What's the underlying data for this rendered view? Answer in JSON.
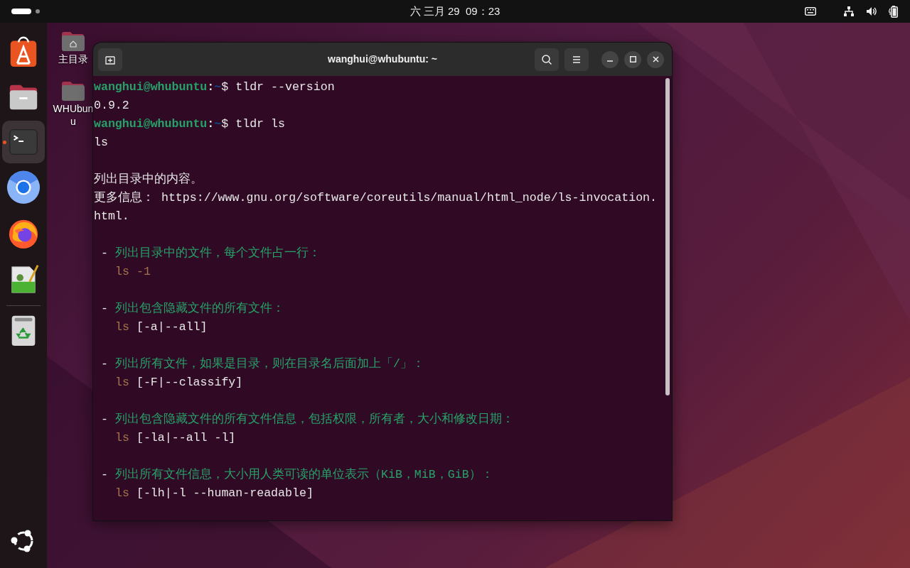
{
  "top_bar": {
    "clock": "六 三月 29  09：23",
    "workspaces": [
      {
        "selected": true
      },
      {
        "selected": false
      }
    ]
  },
  "dock": {
    "items": [
      {
        "kind": "app-center",
        "running": false,
        "selected": false
      },
      {
        "kind": "files",
        "running": false,
        "selected": false
      },
      {
        "kind": "terminal",
        "running": true,
        "selected": true
      },
      {
        "kind": "chromium",
        "running": false,
        "selected": false
      },
      {
        "kind": "firefox",
        "running": false,
        "selected": false
      },
      {
        "kind": "text-editor",
        "running": false,
        "selected": false
      },
      {
        "kind": "trash",
        "running": false,
        "selected": false
      }
    ]
  },
  "desktop_icons": [
    {
      "kind": "home",
      "label_lines": [
        "主目录"
      ]
    },
    {
      "kind": "folder",
      "label_lines": [
        "WHUbun",
        "u"
      ]
    }
  ],
  "terminal": {
    "title": "wanghui@whubuntu: ~",
    "lines": [
      {
        "kind": "prompt",
        "user": "wanghui@whubuntu",
        "separator": ":",
        "path": "~",
        "symbol": "$",
        "command": "tldr --version"
      },
      {
        "kind": "output",
        "text": "0.9.2"
      },
      {
        "kind": "prompt",
        "user": "wanghui@whubuntu",
        "separator": ":",
        "path": "~",
        "symbol": "$",
        "command": "tldr ls"
      },
      {
        "kind": "output",
        "text": "ls"
      },
      {
        "kind": "blank"
      },
      {
        "kind": "output",
        "text": "列出目录中的内容。"
      },
      {
        "kind": "output",
        "text": "更多信息： https://www.gnu.org/software/coreutils/manual/html_node/ls-invocation."
      },
      {
        "kind": "output",
        "text": "html."
      },
      {
        "kind": "blank"
      },
      {
        "kind": "desc",
        "bullet": "-",
        "text": "列出目录中的文件，每个文件占一行："
      },
      {
        "kind": "example",
        "command": "ls",
        "args": "-1"
      },
      {
        "kind": "blank"
      },
      {
        "kind": "desc",
        "bullet": "-",
        "text": "列出包含隐藏文件的所有文件："
      },
      {
        "kind": "example",
        "command": "ls",
        "args": "[-a|--all]"
      },
      {
        "kind": "blank"
      },
      {
        "kind": "desc",
        "bullet": "-",
        "text": "列出所有文件，如果是目录，则在目录名后面加上「/」："
      },
      {
        "kind": "example",
        "command": "ls",
        "args": "[-F|--classify]"
      },
      {
        "kind": "blank"
      },
      {
        "kind": "desc",
        "bullet": "-",
        "text": "列出包含隐藏文件的所有文件信息，包括权限，所有者，大小和修改日期："
      },
      {
        "kind": "example",
        "command": "ls",
        "args": "[-la|--all -l]"
      },
      {
        "kind": "blank"
      },
      {
        "kind": "desc",
        "bullet": "-",
        "text": "列出所有文件信息，大小用人类可读的单位表示（KiB，MiB，GiB）："
      },
      {
        "kind": "example",
        "command": "ls",
        "args": "[-lh|-l --human-readable]"
      }
    ]
  }
}
